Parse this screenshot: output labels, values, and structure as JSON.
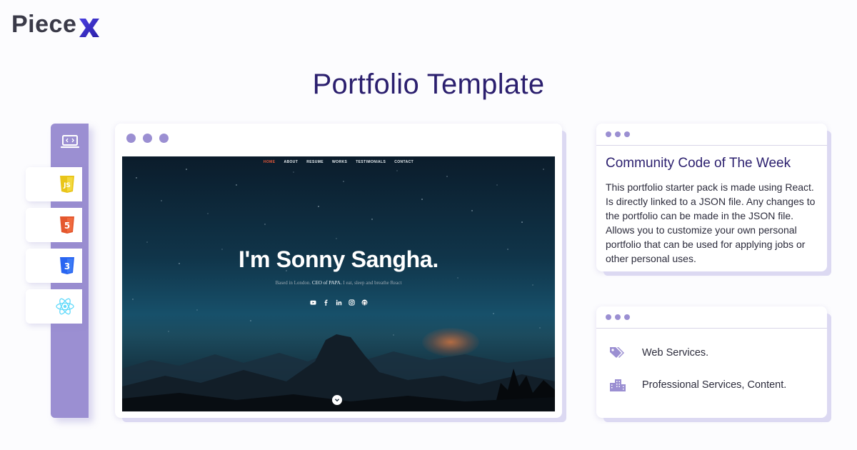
{
  "brand": {
    "logo_main": "Piece",
    "logo_accent": "X",
    "accent_color": "#3c2fd1"
  },
  "page": {
    "title": "Portfolio Template"
  },
  "sidebar": {
    "top_icon": "code-laptop-icon",
    "tech_icons": [
      {
        "name": "javascript-icon",
        "label": "JS",
        "color": "#e9c51a"
      },
      {
        "name": "html5-icon",
        "label": "5",
        "color": "#e4572e"
      },
      {
        "name": "css3-icon",
        "label": "3",
        "color": "#2965f1"
      },
      {
        "name": "react-icon",
        "color": "#61dafb"
      }
    ]
  },
  "preview": {
    "nav": [
      "HOME",
      "ABOUT",
      "RESUME",
      "WORKS",
      "TESTIMONIALS",
      "CONTACT"
    ],
    "active_nav": "HOME",
    "hero_name": "I'm Sonny Sangha.",
    "hero_sub_pre": "Based in London. ",
    "hero_sub_bold": "CEO of PAPA.",
    "hero_sub_post": " I eat, sleep and breathe React",
    "socials": [
      "youtube-icon",
      "facebook-icon",
      "linkedin-icon",
      "instagram-icon",
      "github-icon"
    ]
  },
  "card1": {
    "title": "Community Code of The Week",
    "body": "This portfolio starter pack is made using React. Is directly linked to a JSON file. Any changes to the portfolio can be made in the JSON file. Allows you to customize your own personal portfolio that can be used for applying jobs or other personal uses."
  },
  "card2": {
    "category": "Web Services.",
    "industry": "Professional Services, Content."
  }
}
